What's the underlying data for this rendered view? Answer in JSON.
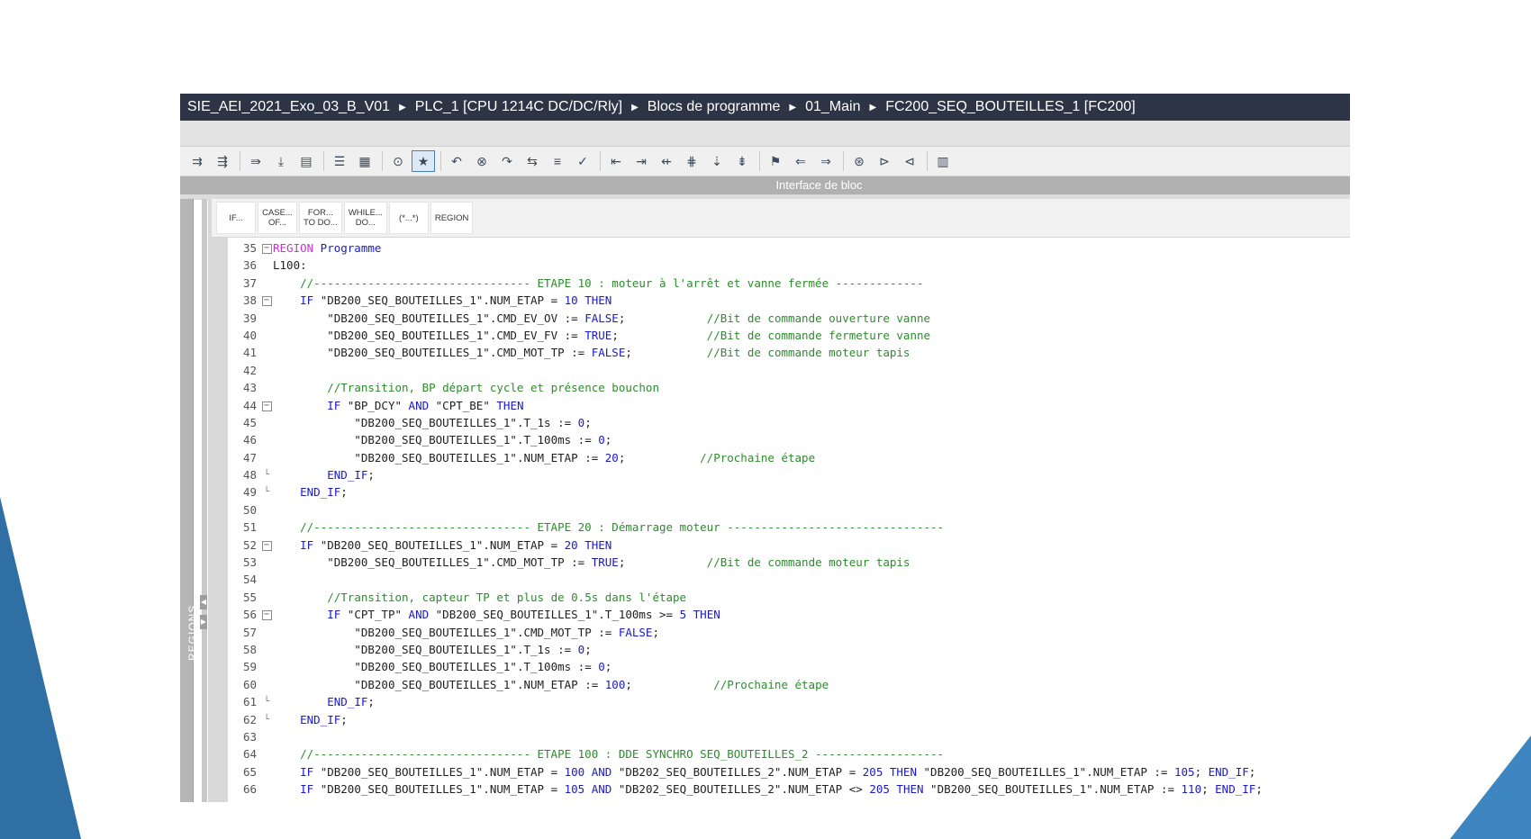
{
  "breadcrumb": [
    "SIE_AEI_2021_Exo_03_B_V01",
    "PLC_1 [CPU 1214C DC/DC/Rly]",
    "Blocs de programme",
    "01_Main",
    "FC200_SEQ_BOUTEILLES_1 [FC200]"
  ],
  "interface_label": "Interface de bloc",
  "regions_label": "REGIONS",
  "snippets": [
    "IF...",
    "CASE...\nOF...",
    "FOR...\nTO DO...",
    "WHILE...\nDO...",
    "(*...*)",
    "REGION"
  ],
  "toolbar_icons": [
    "insert-icon",
    "insert-row-icon",
    "compile-icon",
    "download-icon",
    "monitor-icon",
    "list-icon",
    "comment-icon",
    "breakpoint-icon",
    "favorite-icon",
    "call-icon",
    "call-remove-icon",
    "jump-icon",
    "jump-edit-icon",
    "format-icon",
    "check-icon",
    "indent-left-icon",
    "indent-right-icon",
    "outdent-icon",
    "align-icon",
    "sort-icon",
    "sort-edit-icon",
    "bookmark-icon",
    "bookmark-prev-icon",
    "bookmark-next-icon",
    "watch-icon",
    "watch-go-icon",
    "watch-stop-icon",
    "db-icon"
  ],
  "code_lines": [
    {
      "n": "35",
      "fold": "box",
      "indent": 0,
      "parts": [
        {
          "t": "REGION",
          "c": "reg"
        },
        {
          "t": " Programme",
          "c": "kw"
        }
      ]
    },
    {
      "n": "36",
      "fold": "",
      "indent": 0,
      "parts": [
        {
          "t": "L100:",
          "c": "txt"
        }
      ]
    },
    {
      "n": "37",
      "fold": "",
      "indent": 1,
      "parts": [
        {
          "t": "//-------------------------------- ETAPE 10 : moteur à l'arrêt et vanne fermée -------------",
          "c": "cm"
        }
      ]
    },
    {
      "n": "38",
      "fold": "box",
      "indent": 1,
      "parts": [
        {
          "t": "IF ",
          "c": "kw"
        },
        {
          "t": "\"DB200_SEQ_BOUTEILLES_1\"",
          "c": "str"
        },
        {
          "t": ".NUM_ETAP = ",
          "c": "txt"
        },
        {
          "t": "10",
          "c": "kw"
        },
        {
          "t": " THEN",
          "c": "kw"
        }
      ]
    },
    {
      "n": "39",
      "fold": "",
      "indent": 2,
      "parts": [
        {
          "t": "\"DB200_SEQ_BOUTEILLES_1\"",
          "c": "str"
        },
        {
          "t": ".CMD_EV_OV := ",
          "c": "txt"
        },
        {
          "t": "FALSE",
          "c": "kw"
        },
        {
          "t": ";            ",
          "c": "txt"
        },
        {
          "t": "//Bit de commande ouverture vanne",
          "c": "cm"
        }
      ]
    },
    {
      "n": "40",
      "fold": "",
      "indent": 2,
      "parts": [
        {
          "t": "\"DB200_SEQ_BOUTEILLES_1\"",
          "c": "str"
        },
        {
          "t": ".CMD_EV_FV := ",
          "c": "txt"
        },
        {
          "t": "TRUE",
          "c": "kw"
        },
        {
          "t": ";             ",
          "c": "txt"
        },
        {
          "t": "//Bit de commande fermeture vanne",
          "c": "cm"
        }
      ]
    },
    {
      "n": "41",
      "fold": "",
      "indent": 2,
      "parts": [
        {
          "t": "\"DB200_SEQ_BOUTEILLES_1\"",
          "c": "str"
        },
        {
          "t": ".CMD_MOT_TP := ",
          "c": "txt"
        },
        {
          "t": "FALSE",
          "c": "kw"
        },
        {
          "t": ";           ",
          "c": "txt"
        },
        {
          "t": "//Bit de commande moteur tapis",
          "c": "cm"
        }
      ]
    },
    {
      "n": "42",
      "fold": "",
      "indent": 0,
      "parts": []
    },
    {
      "n": "43",
      "fold": "",
      "indent": 2,
      "parts": [
        {
          "t": "//Transition, BP départ cycle et présence bouchon",
          "c": "cm"
        }
      ]
    },
    {
      "n": "44",
      "fold": "box",
      "indent": 2,
      "parts": [
        {
          "t": "IF ",
          "c": "kw"
        },
        {
          "t": "\"BP_DCY\"",
          "c": "str"
        },
        {
          "t": " AND ",
          "c": "kw"
        },
        {
          "t": "\"CPT_BE\"",
          "c": "str"
        },
        {
          "t": " THEN",
          "c": "kw"
        }
      ]
    },
    {
      "n": "45",
      "fold": "",
      "indent": 3,
      "parts": [
        {
          "t": "\"DB200_SEQ_BOUTEILLES_1\"",
          "c": "str"
        },
        {
          "t": ".T_1s := ",
          "c": "txt"
        },
        {
          "t": "0",
          "c": "kw"
        },
        {
          "t": ";",
          "c": "txt"
        }
      ]
    },
    {
      "n": "46",
      "fold": "",
      "indent": 3,
      "parts": [
        {
          "t": "\"DB200_SEQ_BOUTEILLES_1\"",
          "c": "str"
        },
        {
          "t": ".T_100ms := ",
          "c": "txt"
        },
        {
          "t": "0",
          "c": "kw"
        },
        {
          "t": ";",
          "c": "txt"
        }
      ]
    },
    {
      "n": "47",
      "fold": "",
      "indent": 3,
      "parts": [
        {
          "t": "\"DB200_SEQ_BOUTEILLES_1\"",
          "c": "str"
        },
        {
          "t": ".NUM_ETAP := ",
          "c": "txt"
        },
        {
          "t": "20",
          "c": "kw"
        },
        {
          "t": ";           ",
          "c": "txt"
        },
        {
          "t": "//Prochaine étape",
          "c": "cm"
        }
      ]
    },
    {
      "n": "48",
      "fold": "end",
      "indent": 2,
      "parts": [
        {
          "t": "END_IF",
          "c": "kw"
        },
        {
          "t": ";",
          "c": "txt"
        }
      ]
    },
    {
      "n": "49",
      "fold": "end",
      "indent": 1,
      "parts": [
        {
          "t": "END_IF",
          "c": "kw"
        },
        {
          "t": ";",
          "c": "txt"
        }
      ]
    },
    {
      "n": "50",
      "fold": "",
      "indent": 0,
      "parts": []
    },
    {
      "n": "51",
      "fold": "",
      "indent": 1,
      "parts": [
        {
          "t": "//-------------------------------- ETAPE 20 : Démarrage moteur --------------------------------",
          "c": "cm"
        }
      ]
    },
    {
      "n": "52",
      "fold": "box",
      "indent": 1,
      "parts": [
        {
          "t": "IF ",
          "c": "kw"
        },
        {
          "t": "\"DB200_SEQ_BOUTEILLES_1\"",
          "c": "str"
        },
        {
          "t": ".NUM_ETAP = ",
          "c": "txt"
        },
        {
          "t": "20",
          "c": "kw"
        },
        {
          "t": " THEN",
          "c": "kw"
        }
      ]
    },
    {
      "n": "53",
      "fold": "",
      "indent": 2,
      "parts": [
        {
          "t": "\"DB200_SEQ_BOUTEILLES_1\"",
          "c": "str"
        },
        {
          "t": ".CMD_MOT_TP := ",
          "c": "txt"
        },
        {
          "t": "TRUE",
          "c": "kw"
        },
        {
          "t": ";            ",
          "c": "txt"
        },
        {
          "t": "//Bit de commande moteur tapis",
          "c": "cm"
        }
      ]
    },
    {
      "n": "54",
      "fold": "",
      "indent": 0,
      "parts": []
    },
    {
      "n": "55",
      "fold": "",
      "indent": 2,
      "parts": [
        {
          "t": "//Transition, capteur TP et plus de 0.5s dans l'étape",
          "c": "cm"
        }
      ]
    },
    {
      "n": "56",
      "fold": "box",
      "indent": 2,
      "parts": [
        {
          "t": "IF ",
          "c": "kw"
        },
        {
          "t": "\"CPT_TP\"",
          "c": "str"
        },
        {
          "t": " AND ",
          "c": "kw"
        },
        {
          "t": "\"DB200_SEQ_BOUTEILLES_1\"",
          "c": "str"
        },
        {
          "t": ".T_100ms >= ",
          "c": "txt"
        },
        {
          "t": "5",
          "c": "kw"
        },
        {
          "t": " THEN",
          "c": "kw"
        }
      ]
    },
    {
      "n": "57",
      "fold": "",
      "indent": 3,
      "parts": [
        {
          "t": "\"DB200_SEQ_BOUTEILLES_1\"",
          "c": "str"
        },
        {
          "t": ".CMD_MOT_TP := ",
          "c": "txt"
        },
        {
          "t": "FALSE",
          "c": "kw"
        },
        {
          "t": ";",
          "c": "txt"
        }
      ]
    },
    {
      "n": "58",
      "fold": "",
      "indent": 3,
      "parts": [
        {
          "t": "\"DB200_SEQ_BOUTEILLES_1\"",
          "c": "str"
        },
        {
          "t": ".T_1s := ",
          "c": "txt"
        },
        {
          "t": "0",
          "c": "kw"
        },
        {
          "t": ";",
          "c": "txt"
        }
      ]
    },
    {
      "n": "59",
      "fold": "",
      "indent": 3,
      "parts": [
        {
          "t": "\"DB200_SEQ_BOUTEILLES_1\"",
          "c": "str"
        },
        {
          "t": ".T_100ms := ",
          "c": "txt"
        },
        {
          "t": "0",
          "c": "kw"
        },
        {
          "t": ";",
          "c": "txt"
        }
      ]
    },
    {
      "n": "60",
      "fold": "",
      "indent": 3,
      "parts": [
        {
          "t": "\"DB200_SEQ_BOUTEILLES_1\"",
          "c": "str"
        },
        {
          "t": ".NUM_ETAP := ",
          "c": "txt"
        },
        {
          "t": "100",
          "c": "kw"
        },
        {
          "t": ";            ",
          "c": "txt"
        },
        {
          "t": "//Prochaine étape",
          "c": "cm"
        }
      ]
    },
    {
      "n": "61",
      "fold": "end",
      "indent": 2,
      "parts": [
        {
          "t": "END_IF",
          "c": "kw"
        },
        {
          "t": ";",
          "c": "txt"
        }
      ]
    },
    {
      "n": "62",
      "fold": "end",
      "indent": 1,
      "parts": [
        {
          "t": "END_IF",
          "c": "kw"
        },
        {
          "t": ";",
          "c": "txt"
        }
      ]
    },
    {
      "n": "63",
      "fold": "",
      "indent": 0,
      "parts": []
    },
    {
      "n": "64",
      "fold": "",
      "indent": 1,
      "parts": [
        {
          "t": "//-------------------------------- ETAPE 100 : DDE SYNCHRO SEQ_BOUTEILLES_2 -------------------",
          "c": "cm"
        }
      ]
    },
    {
      "n": "65",
      "fold": "",
      "indent": 1,
      "parts": [
        {
          "t": "IF ",
          "c": "kw"
        },
        {
          "t": "\"DB200_SEQ_BOUTEILLES_1\"",
          "c": "str"
        },
        {
          "t": ".NUM_ETAP = ",
          "c": "txt"
        },
        {
          "t": "100",
          "c": "kw"
        },
        {
          "t": " AND ",
          "c": "kw"
        },
        {
          "t": "\"DB202_SEQ_BOUTEILLES_2\"",
          "c": "str"
        },
        {
          "t": ".NUM_ETAP = ",
          "c": "txt"
        },
        {
          "t": "205",
          "c": "kw"
        },
        {
          "t": " THEN ",
          "c": "kw"
        },
        {
          "t": "\"DB200_SEQ_BOUTEILLES_1\"",
          "c": "str"
        },
        {
          "t": ".NUM_ETAP := ",
          "c": "txt"
        },
        {
          "t": "105",
          "c": "kw"
        },
        {
          "t": "; ",
          "c": "txt"
        },
        {
          "t": "END_IF",
          "c": "kw"
        },
        {
          "t": ";",
          "c": "txt"
        }
      ]
    },
    {
      "n": "66",
      "fold": "",
      "indent": 1,
      "parts": [
        {
          "t": "IF ",
          "c": "kw"
        },
        {
          "t": "\"DB200_SEQ_BOUTEILLES_1\"",
          "c": "str"
        },
        {
          "t": ".NUM_ETAP = ",
          "c": "txt"
        },
        {
          "t": "105",
          "c": "kw"
        },
        {
          "t": " AND ",
          "c": "kw"
        },
        {
          "t": "\"DB202_SEQ_BOUTEILLES_2\"",
          "c": "str"
        },
        {
          "t": ".NUM_ETAP <> ",
          "c": "txt"
        },
        {
          "t": "205",
          "c": "kw"
        },
        {
          "t": " THEN ",
          "c": "kw"
        },
        {
          "t": "\"DB200_SEQ_BOUTEILLES_1\"",
          "c": "str"
        },
        {
          "t": ".NUM_ETAP := ",
          "c": "txt"
        },
        {
          "t": "110",
          "c": "kw"
        },
        {
          "t": "; ",
          "c": "txt"
        },
        {
          "t": "END_IF",
          "c": "kw"
        },
        {
          "t": ";",
          "c": "txt"
        }
      ]
    }
  ]
}
